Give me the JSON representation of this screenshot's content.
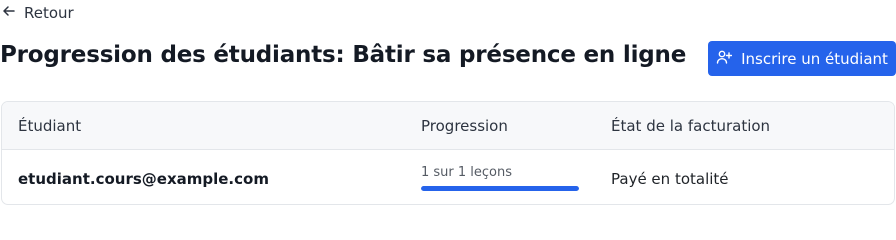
{
  "nav": {
    "back_label": "Retour"
  },
  "page": {
    "title": "Progression des étudiants: Bâtir sa présence en ligne"
  },
  "actions": {
    "enroll_label": "Inscrire un étudiant"
  },
  "table": {
    "headers": [
      "Étudiant",
      "Progression",
      "État de la facturation"
    ],
    "rows": [
      {
        "student": "etudiant.cours@example.com",
        "progress_text": "1 sur 1 leçons",
        "progress_fraction": 1.0,
        "billing": "Payé en totalité"
      }
    ]
  },
  "colors": {
    "accent": "#2563eb",
    "header_bg": "#f7f8fa",
    "border": "#e3e6ea"
  },
  "icons": {
    "back": "arrow-left-icon",
    "enroll": "user-plus-icon"
  }
}
